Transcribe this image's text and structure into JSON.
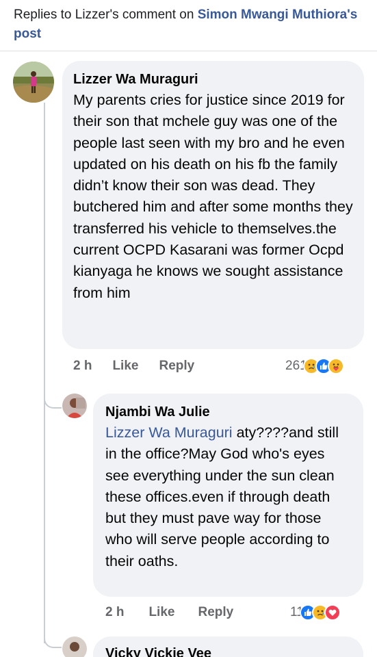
{
  "header": {
    "prefix": "Replies to Lizzer's comment on ",
    "post_author": "Simon Mwangi Muthiora",
    "suffix": "'s post"
  },
  "comments": [
    {
      "author": "Lizzer Wa Muraguri",
      "text": "My parents cries  for justice since 2019 for their son that mchele guy was one of the people last seen with my bro and he even updated on his death on his fb the family didn’t know their son was dead. They butchered him and after some months they transferred his vehicle to themselves.the current OCPD Kasarani was former Ocpd kianyaga he knows we sought assistance from him",
      "time": "2 h",
      "like_label": "Like",
      "reply_label": "Reply",
      "reaction_count": "261",
      "reactions": [
        "sad-reaction-icon",
        "like-reaction-icon",
        "care-reaction-icon"
      ]
    },
    {
      "author": "Njambi Wa Julie",
      "mention": "Lizzer Wa Muraguri",
      "text": " aty????and still in the office?May God who's eyes see everything under the sun clean these offices.even if through death but they must pave way for those who will serve people according to their oaths.",
      "time": "2 h",
      "like_label": "Like",
      "reply_label": "Reply",
      "reaction_count": "11",
      "reactions": [
        "like-reaction-icon",
        "sad-reaction-icon",
        "love-reaction-icon"
      ]
    },
    {
      "author": "Vicky Vickie Vee"
    }
  ],
  "colors": {
    "link": "#385898",
    "bubble": "#f0f2f5",
    "meta": "#65676b",
    "like_blue": "#1877f2",
    "reaction_yellow": "#f7b928",
    "love_red": "#f33e58"
  }
}
